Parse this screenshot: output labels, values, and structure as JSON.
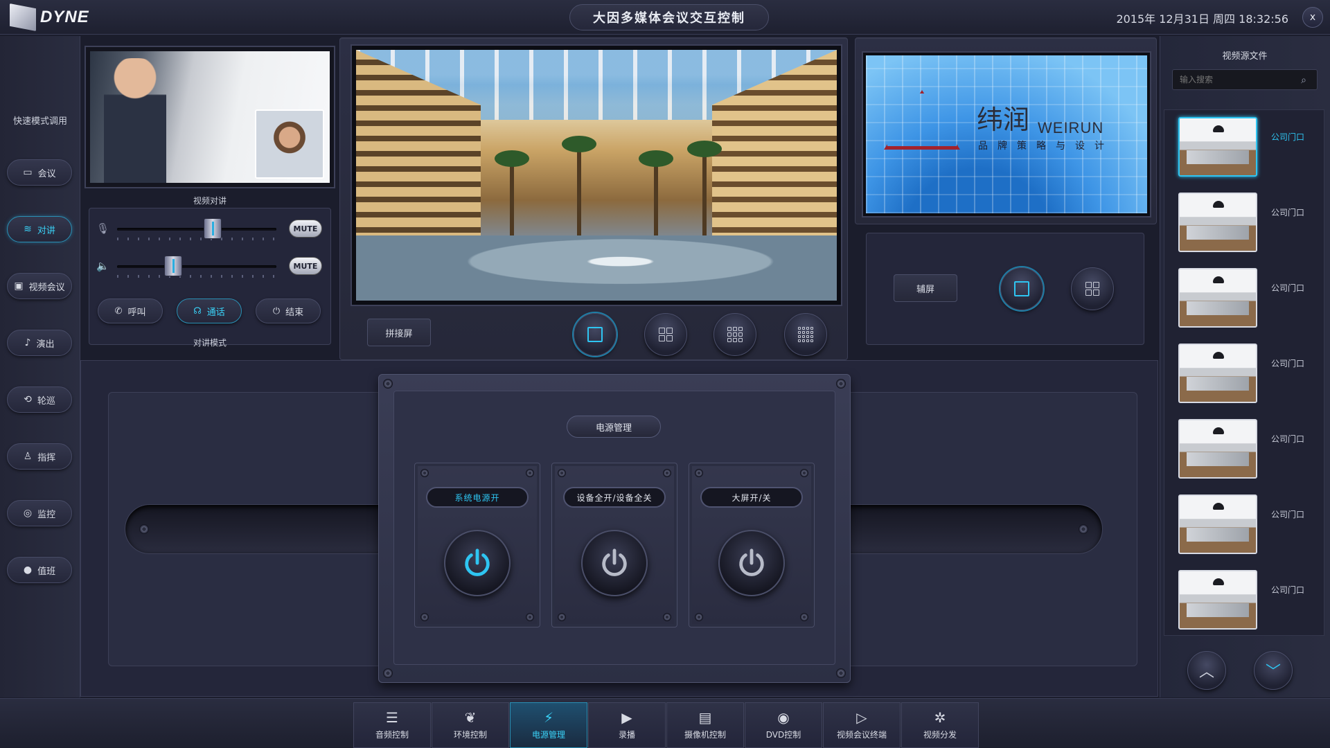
{
  "header": {
    "logo_text": "DYNE",
    "title": "大因多媒体会议交互控制",
    "datetime": "2015年 12月31日 周四 18:32:56",
    "close_label": "x"
  },
  "sidebar": {
    "section_label": "快速模式调用",
    "items": [
      {
        "label": "会议",
        "icon": "chat-icon",
        "active": false
      },
      {
        "label": "对讲",
        "icon": "wifi-icon",
        "active": true
      },
      {
        "label": "视频会议",
        "icon": "video-conference-icon",
        "active": false
      },
      {
        "label": "演出",
        "icon": "performer-icon",
        "active": false
      },
      {
        "label": "轮巡",
        "icon": "loop-icon",
        "active": false
      },
      {
        "label": "指挥",
        "icon": "conductor-icon",
        "active": false
      },
      {
        "label": "监控",
        "icon": "camera-icon",
        "active": false
      },
      {
        "label": "值班",
        "icon": "user-icon",
        "active": false
      }
    ]
  },
  "intercom": {
    "video_caption": "视频对讲",
    "mic_mute": "MUTE",
    "speaker_mute": "MUTE",
    "mic_level": 0.6,
    "speaker_level": 0.35,
    "buttons": [
      {
        "label": "呼叫",
        "icon": "phone-icon",
        "active": false
      },
      {
        "label": "通话",
        "icon": "headset-icon",
        "active": true
      },
      {
        "label": "结束",
        "icon": "power-icon",
        "active": false
      }
    ],
    "mode_caption": "对讲模式"
  },
  "main_screen": {
    "splice_label": "拼接屏",
    "layouts": [
      "1x1",
      "2x2",
      "3x3",
      "4x4"
    ],
    "active_layout": "1x1"
  },
  "aux_screen": {
    "brand_cn": "纬润",
    "brand_en": "WEIRUN",
    "brand_sub": "品牌策略与设计",
    "label": "辅屏",
    "layouts": [
      "1x1",
      "2x2"
    ],
    "active_layout": "1x1"
  },
  "sources": {
    "title": "视频源文件",
    "search_placeholder": "输入搜索",
    "items": [
      {
        "name": "公司门口",
        "active": true
      },
      {
        "name": "公司门口",
        "active": false
      },
      {
        "name": "公司门口",
        "active": false
      },
      {
        "name": "公司门口",
        "active": false
      },
      {
        "name": "公司门口",
        "active": false
      },
      {
        "name": "公司门口",
        "active": false
      },
      {
        "name": "公司门口",
        "active": false
      }
    ]
  },
  "power": {
    "title": "电源管理",
    "cards": [
      {
        "label": "系统电源开",
        "on": true
      },
      {
        "label": "设备全开/设备全关",
        "on": false
      },
      {
        "label": "大屏开/关",
        "on": false
      }
    ]
  },
  "bottom_nav": {
    "items": [
      {
        "label": "音频控制",
        "icon": "mixer-icon",
        "active": false
      },
      {
        "label": "环境控制",
        "icon": "leaf-icon",
        "active": false
      },
      {
        "label": "电源管理",
        "icon": "plug-icon",
        "active": true
      },
      {
        "label": "录播",
        "icon": "play-icon",
        "active": false
      },
      {
        "label": "摄像机控制",
        "icon": "video-camera-icon",
        "active": false
      },
      {
        "label": "DVD控制",
        "icon": "disc-icon",
        "active": false
      },
      {
        "label": "视频会议终端",
        "icon": "monitor-play-icon",
        "active": false
      },
      {
        "label": "视频分发",
        "icon": "film-reel-icon",
        "active": false
      }
    ]
  },
  "colors": {
    "accent": "#2ec5f2",
    "background": "#1b1d2c"
  }
}
